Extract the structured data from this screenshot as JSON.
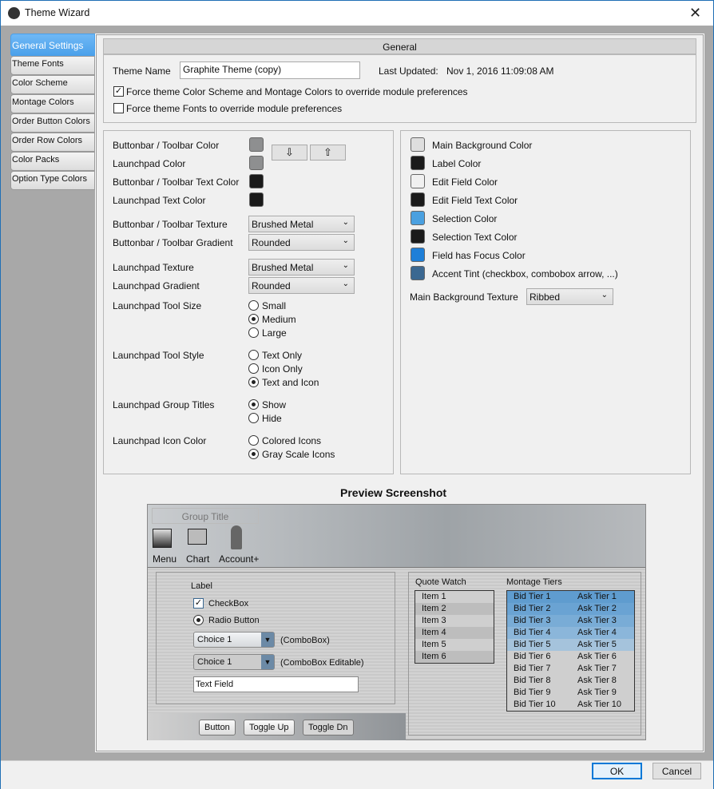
{
  "window": {
    "title": "Theme Wizard",
    "close_icon": "close-icon"
  },
  "sidebar": {
    "items": [
      {
        "label": "General Settings",
        "selected": true
      },
      {
        "label": "Theme Fonts"
      },
      {
        "label": "Color Scheme"
      },
      {
        "label": "Montage Colors"
      },
      {
        "label": "Order Button Colors"
      },
      {
        "label": "Order Row Colors"
      },
      {
        "label": "Color Packs"
      },
      {
        "label": "Option Type Colors"
      }
    ]
  },
  "general": {
    "header": "General",
    "theme_name_label": "Theme Name",
    "theme_name_value": "Graphite Theme (copy)",
    "last_updated_label": "Last Updated:",
    "last_updated_value": "Nov 1, 2016  11:09:08 AM",
    "force_colors": {
      "label": "Force theme Color Scheme and Montage Colors to override module preferences",
      "checked": true
    },
    "force_fonts": {
      "label": "Force theme Fonts to override module preferences",
      "checked": false
    }
  },
  "left_panel": {
    "colors": [
      {
        "label": "Buttonbar / Toolbar Color",
        "color": "#8e8f90"
      },
      {
        "label": "Launchpad Color",
        "color": "#8e8f90"
      },
      {
        "label": "Buttonbar / Toolbar Text Color",
        "color": "#1a1a1a"
      },
      {
        "label": "Launchpad Text Color",
        "color": "#1a1a1a"
      }
    ],
    "move_down_icon": "arrow-down-icon",
    "move_up_icon": "arrow-up-icon",
    "dropdowns": [
      {
        "label": "Buttonbar / Toolbar Texture",
        "value": "Brushed Metal"
      },
      {
        "label": "Buttonbar / Toolbar Gradient",
        "value": "Rounded"
      },
      {
        "label": "Launchpad Texture",
        "value": "Brushed Metal"
      },
      {
        "label": "Launchpad Gradient",
        "value": "Rounded"
      }
    ],
    "radio_groups": [
      {
        "label": "Launchpad Tool Size",
        "options": [
          "Small",
          "Medium",
          "Large"
        ],
        "selected": 1
      },
      {
        "label": "Launchpad Tool Style",
        "options": [
          "Text Only",
          "Icon Only",
          "Text and Icon"
        ],
        "selected": 2
      },
      {
        "label": "Launchpad Group Titles",
        "options": [
          "Show",
          "Hide"
        ],
        "selected": 0
      },
      {
        "label": "Launchpad Icon Color",
        "options": [
          "Colored Icons",
          "Gray Scale Icons"
        ],
        "selected": 1
      }
    ]
  },
  "right_panel": {
    "colors": [
      {
        "label": "Main Background Color",
        "color": "#dedede"
      },
      {
        "label": "Label Color",
        "color": "#1a1a1a"
      },
      {
        "label": "Edit Field Color",
        "color": "#f0f0f0"
      },
      {
        "label": "Edit Field Text Color",
        "color": "#1a1a1a"
      },
      {
        "label": "Selection Color",
        "color": "#4aa0e0"
      },
      {
        "label": "Selection Text Color",
        "color": "#1a1a1a"
      },
      {
        "label": "Field has Focus Color",
        "color": "#1e7fd8"
      },
      {
        "label": "Accent Tint (checkbox, combobox arrow, ...)",
        "color": "#3b6891"
      }
    ],
    "texture_label": "Main Background Texture",
    "texture_value": "Ribbed"
  },
  "preview": {
    "title": "Preview Screenshot",
    "group_title": "Group Title",
    "tools": [
      "Menu",
      "Chart",
      "Account+"
    ],
    "label": "Label",
    "checkbox": "CheckBox",
    "radio": "Radio Button",
    "combo_value": "Choice 1",
    "combo_label": "(ComboBox)",
    "combo_edit_value": "Choice 1",
    "combo_edit_label": "(ComboBox Editable)",
    "text_field": "Text Field",
    "buttons": [
      "Button",
      "Toggle Up",
      "Toggle Dn"
    ],
    "quote_watch_title": "Quote Watch",
    "quote_items": [
      "Item 1",
      "Item 2",
      "Item 3",
      "Item 4",
      "Item 5",
      "Item 6"
    ],
    "montage_title": "Montage Tiers",
    "bid_tiers": [
      "Bid Tier 1",
      "Bid Tier 2",
      "Bid Tier 3",
      "Bid Tier 4",
      "Bid Tier 5",
      "Bid Tier 6",
      "Bid Tier 7",
      "Bid Tier 8",
      "Bid Tier 9",
      "Bid Tier 10"
    ],
    "ask_tiers": [
      "Ask Tier 1",
      "Ask Tier 2",
      "Ask Tier 3",
      "Ask Tier 4",
      "Ask Tier 5",
      "Ask Tier 6",
      "Ask Tier 7",
      "Ask Tier 8",
      "Ask Tier 9",
      "Ask Tier 10"
    ],
    "tier_colors": [
      "#5f9ccf",
      "#6aa3d3",
      "#79acd6",
      "#8bb6da",
      "#a5c3dc"
    ]
  },
  "footer": {
    "ok": "OK",
    "cancel": "Cancel"
  }
}
